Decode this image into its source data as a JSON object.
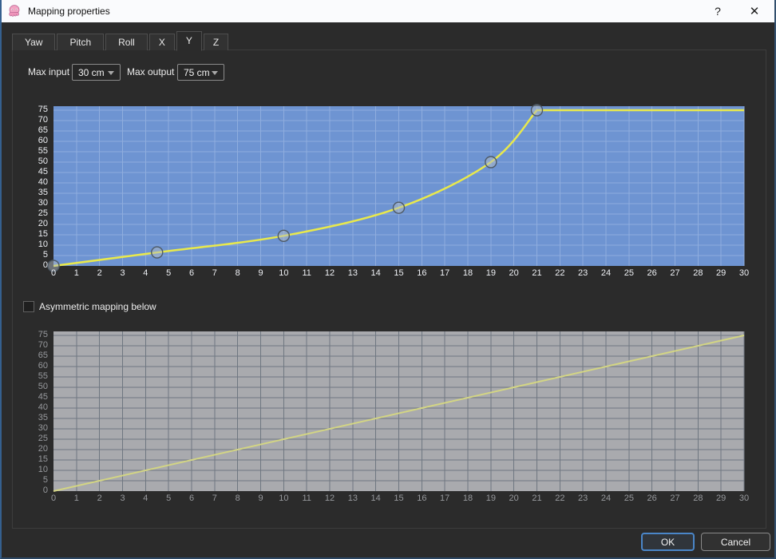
{
  "window": {
    "title": "Mapping properties",
    "help_label": "?",
    "close_label": "✕"
  },
  "tabs": [
    {
      "label": "Yaw",
      "selected": false,
      "small": false
    },
    {
      "label": "Pitch",
      "selected": false,
      "small": false
    },
    {
      "label": "Roll",
      "selected": false,
      "small": false
    },
    {
      "label": "X",
      "selected": false,
      "small": true
    },
    {
      "label": "Y",
      "selected": true,
      "small": true
    },
    {
      "label": "Z",
      "selected": false,
      "small": true
    }
  ],
  "controls": {
    "max_input_label": "Max input",
    "max_input_value": "30 cm",
    "max_output_label": "Max output",
    "max_output_value": "75 cm"
  },
  "checkbox": {
    "label": "Asymmetric mapping below",
    "checked": false
  },
  "buttons": {
    "ok": "OK",
    "cancel": "Cancel"
  },
  "chart_data": [
    {
      "type": "line",
      "name": "y-axis-mapping-active",
      "xlim": [
        0,
        30
      ],
      "ylim": [
        0,
        75
      ],
      "x_ticks": [
        0,
        1,
        2,
        3,
        4,
        5,
        6,
        7,
        8,
        9,
        10,
        11,
        12,
        13,
        14,
        15,
        16,
        17,
        18,
        19,
        20,
        21,
        22,
        23,
        24,
        25,
        26,
        27,
        28,
        29,
        30
      ],
      "y_ticks": [
        0,
        5,
        10,
        15,
        20,
        25,
        30,
        35,
        40,
        45,
        50,
        55,
        60,
        65,
        70,
        75
      ],
      "grid": true,
      "series": [
        {
          "name": "mapping-curve",
          "points": [
            [
              0,
              0
            ],
            [
              4.5,
              6.5
            ],
            [
              10,
              14.5
            ],
            [
              15,
              28
            ],
            [
              19,
              50
            ],
            [
              21,
              75
            ]
          ],
          "extends_flat_to_x": 30
        }
      ],
      "show_points": true,
      "disabled": false,
      "bg": "#6e94d2",
      "grid_color": "#8fadde",
      "line_color": "#e9e94b",
      "point_fill": "rgba(175,185,195,0.5)",
      "point_stroke": "#4e5a66",
      "tick_color": "#eef0f4"
    },
    {
      "type": "line",
      "name": "y-axis-mapping-disabled-linear",
      "xlim": [
        0,
        30
      ],
      "ylim": [
        0,
        75
      ],
      "x_ticks": [
        0,
        1,
        2,
        3,
        4,
        5,
        6,
        7,
        8,
        9,
        10,
        11,
        12,
        13,
        14,
        15,
        16,
        17,
        18,
        19,
        20,
        21,
        22,
        23,
        24,
        25,
        26,
        27,
        28,
        29,
        30
      ],
      "y_ticks": [
        0,
        5,
        10,
        15,
        20,
        25,
        30,
        35,
        40,
        45,
        50,
        55,
        60,
        65,
        70,
        75
      ],
      "grid": true,
      "series": [
        {
          "name": "linear-mapping-line",
          "points": [
            [
              0,
              0
            ],
            [
              30,
              75
            ]
          ]
        }
      ],
      "show_points": false,
      "disabled": true,
      "bg": "#a9aaae",
      "grid_color": "#6f7781",
      "line_color": "#d3d584",
      "tick_color": "#97999d"
    }
  ]
}
